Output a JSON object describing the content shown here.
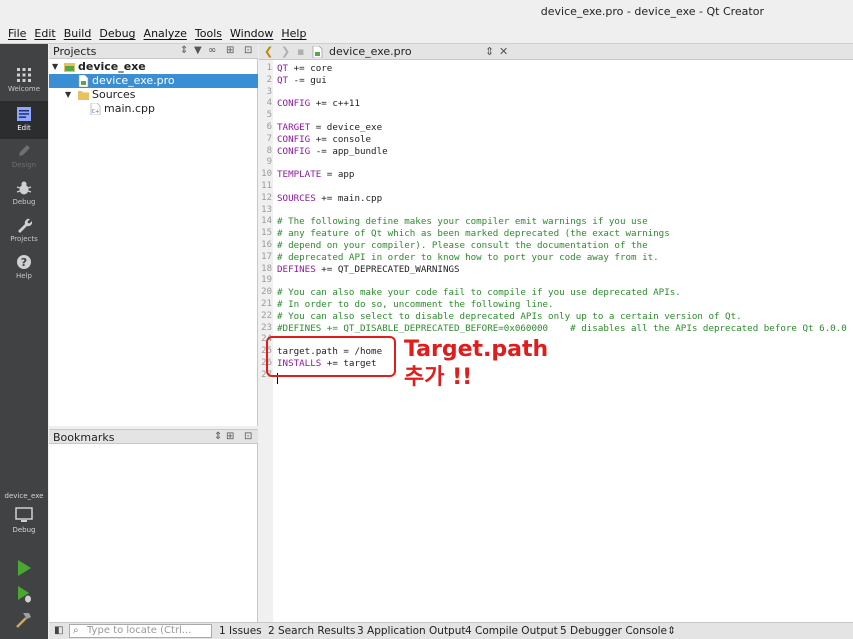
{
  "window": {
    "title": "device_exe.pro - device_exe - Qt Creator"
  },
  "menu": [
    "File",
    "Edit",
    "Build",
    "Debug",
    "Analyze",
    "Tools",
    "Window",
    "Help"
  ],
  "modes": [
    {
      "label": "Welcome",
      "icon": "grid-icon"
    },
    {
      "label": "Edit",
      "icon": "edit-icon"
    },
    {
      "label": "Design",
      "icon": "pencil-icon"
    },
    {
      "label": "Debug",
      "icon": "bug-icon"
    },
    {
      "label": "Projects",
      "icon": "wrench-icon"
    },
    {
      "label": "Help",
      "icon": "help-icon"
    }
  ],
  "kit": {
    "project": "device_exe",
    "config": "Debug"
  },
  "projects_panel": {
    "title": "Projects",
    "tree": [
      {
        "label": "device_exe",
        "level": 0,
        "expanded": true,
        "icon": "project-folder-icon",
        "bold": true
      },
      {
        "label": "device_exe.pro",
        "level": 1,
        "icon": "pro-file-icon",
        "selected": true
      },
      {
        "label": "Sources",
        "level": 1,
        "expanded": true,
        "icon": "folder-icon"
      },
      {
        "label": "main.cpp",
        "level": 2,
        "icon": "cpp-file-icon"
      }
    ]
  },
  "bookmarks_panel": {
    "title": "Bookmarks"
  },
  "editor": {
    "filename": "device_exe.pro",
    "lines": [
      {
        "n": "1",
        "parts": [
          [
            "kw",
            "QT"
          ],
          [
            "pl",
            " += core"
          ]
        ]
      },
      {
        "n": "2",
        "parts": [
          [
            "kw",
            "QT"
          ],
          [
            "pl",
            " -= gui"
          ]
        ]
      },
      {
        "n": "3",
        "parts": []
      },
      {
        "n": "4",
        "parts": [
          [
            "kw",
            "CONFIG"
          ],
          [
            "pl",
            " += c++11"
          ]
        ]
      },
      {
        "n": "5",
        "parts": []
      },
      {
        "n": "6",
        "parts": [
          [
            "kw",
            "TARGET"
          ],
          [
            "pl",
            " = device_exe"
          ]
        ]
      },
      {
        "n": "7",
        "parts": [
          [
            "kw",
            "CONFIG"
          ],
          [
            "pl",
            " += console"
          ]
        ]
      },
      {
        "n": "8",
        "parts": [
          [
            "kw",
            "CONFIG"
          ],
          [
            "pl",
            " -= app_bundle"
          ]
        ]
      },
      {
        "n": "9",
        "parts": []
      },
      {
        "n": "10",
        "parts": [
          [
            "kw",
            "TEMPLATE"
          ],
          [
            "pl",
            " = app"
          ]
        ]
      },
      {
        "n": "11",
        "parts": []
      },
      {
        "n": "12",
        "parts": [
          [
            "kw",
            "SOURCES"
          ],
          [
            "pl",
            " += main.cpp"
          ]
        ]
      },
      {
        "n": "13",
        "parts": []
      },
      {
        "n": "14",
        "parts": [
          [
            "cm",
            "# The following define makes your compiler emit warnings if you use"
          ]
        ]
      },
      {
        "n": "15",
        "parts": [
          [
            "cm",
            "# any feature of Qt which as been marked deprecated (the exact warnings"
          ]
        ]
      },
      {
        "n": "16",
        "parts": [
          [
            "cm",
            "# depend on your compiler). Please consult the documentation of the"
          ]
        ]
      },
      {
        "n": "17",
        "parts": [
          [
            "cm",
            "# deprecated API in order to know how to port your code away from it."
          ]
        ]
      },
      {
        "n": "18",
        "parts": [
          [
            "kw",
            "DEFINES"
          ],
          [
            "pl",
            " += QT_DEPRECATED_WARNINGS"
          ]
        ]
      },
      {
        "n": "19",
        "parts": []
      },
      {
        "n": "20",
        "parts": [
          [
            "cm",
            "# You can also make your code fail to compile if you use deprecated APIs."
          ]
        ]
      },
      {
        "n": "21",
        "parts": [
          [
            "cm",
            "# In order to do so, uncomment the following line."
          ]
        ]
      },
      {
        "n": "22",
        "parts": [
          [
            "cm",
            "# You can also select to disable deprecated APIs only up to a certain version of Qt."
          ]
        ]
      },
      {
        "n": "23",
        "parts": [
          [
            "cm",
            "#DEFINES += QT_DISABLE_DEPRECATED_BEFORE=0x060000    # disables all the APIs deprecated before Qt 6.0.0"
          ]
        ]
      },
      {
        "n": "24",
        "parts": []
      },
      {
        "n": "25",
        "parts": [
          [
            "pl",
            "target.path = /home"
          ]
        ]
      },
      {
        "n": "26",
        "parts": [
          [
            "kw",
            "INSTALLS"
          ],
          [
            "pl",
            " += target"
          ]
        ]
      },
      {
        "n": "27",
        "parts": []
      }
    ]
  },
  "annotation": {
    "line1": "Target.path",
    "line2": "추가 !!"
  },
  "status": {
    "locate_placeholder": "Type to locate (Ctrl...",
    "tabs": [
      "1 Issues",
      "2 Search Results",
      "3 Application Output",
      "4 Compile Output",
      "5 Debugger Console"
    ]
  },
  "colors": {
    "accent": "#3a8fd4",
    "annotation": "#e01c1c",
    "keyword": "#8b1a9e",
    "comment": "#2e8b2e",
    "modebar": "#404244"
  }
}
